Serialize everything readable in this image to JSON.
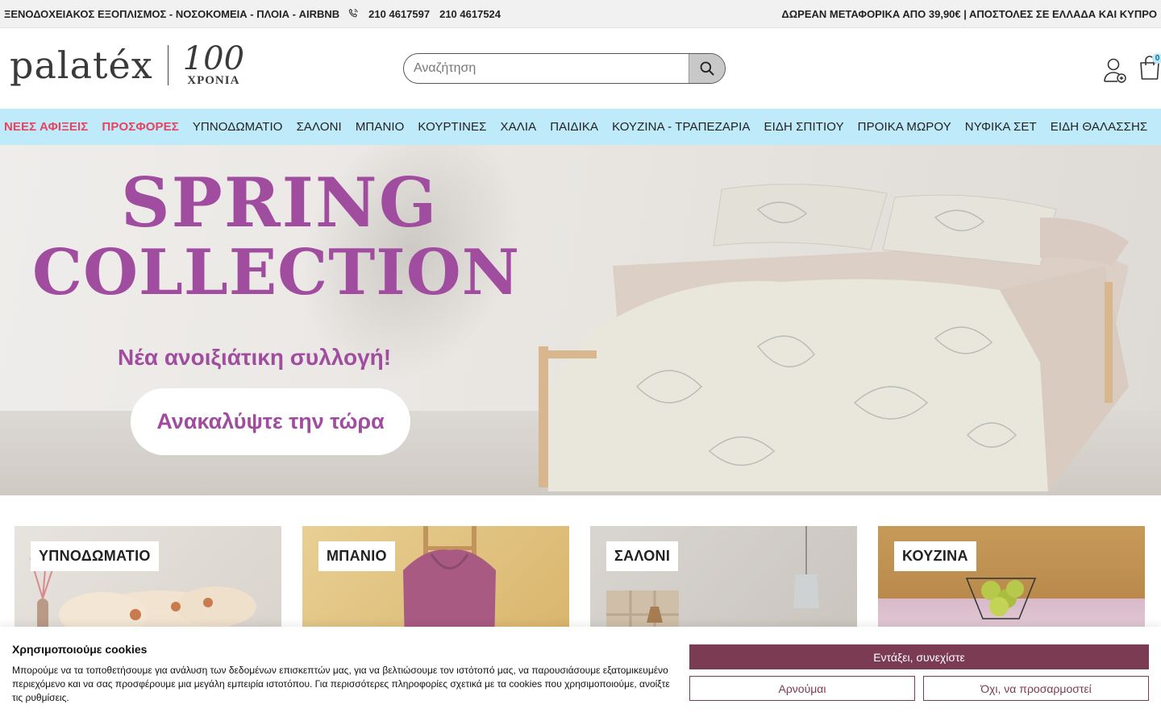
{
  "topbar": {
    "left_text": "ΞΕΝΟΔΟΧΕΙΑΚΟΣ ΕΞΟΠΛΙΣΜΟΣ - ΝΟΣΟΚΟΜΕΙΑ - ΠΛΟΙΑ - AIRBNB",
    "phone1": "210 4617597",
    "phone2": "210 4617524",
    "right_text": "ΔΩΡΕΑΝ ΜΕΤΑΦΟΡΙΚΑ ΑΠΟ 39,90€ | ΑΠΟΣΤΟΛΕΣ ΣΕ ΕΛΛΑΔΑ ΚΑΙ ΚΥΠΡΟ"
  },
  "header": {
    "logo_text": "palatéx",
    "logo_100": "100",
    "logo_years": "ΧΡΟΝΙΑ",
    "search_placeholder": "Αναζήτηση",
    "cart_count": "0"
  },
  "nav": {
    "items": [
      {
        "label": "ΝΕΕΣ ΑΦΙΞΕΙΣ",
        "highlight": true
      },
      {
        "label": "ΠΡΟΣΦΟΡΕΣ",
        "highlight": true
      },
      {
        "label": "ΥΠΝΟΔΩΜΑΤΙΟ",
        "highlight": false
      },
      {
        "label": "ΣΑΛΟΝΙ",
        "highlight": false
      },
      {
        "label": "ΜΠΑΝΙΟ",
        "highlight": false
      },
      {
        "label": "ΚΟΥΡΤΙΝΕΣ",
        "highlight": false
      },
      {
        "label": "ΧΑΛΙΑ",
        "highlight": false
      },
      {
        "label": "ΠΑΙΔΙΚΑ",
        "highlight": false
      },
      {
        "label": "ΚΟΥΖΙΝΑ - ΤΡΑΠΕΖΑΡΙΑ",
        "highlight": false
      },
      {
        "label": "ΕΙΔΗ ΣΠΙΤΙΟΥ",
        "highlight": false
      },
      {
        "label": "ΠΡΟΙΚΑ ΜΩΡΟΥ",
        "highlight": false
      },
      {
        "label": "ΝΥΦΙΚΑ ΣΕΤ",
        "highlight": false
      },
      {
        "label": "ΕΙΔΗ ΘΑΛΑΣΣΗΣ",
        "highlight": false
      }
    ]
  },
  "hero": {
    "title_line1": "SPRING",
    "title_line2": "COLLECTION",
    "subtitle": "Νέα ανοιξιάτικη συλλογή!",
    "cta": "Ανακαλύψτε την τώρα",
    "accent_color": "#a04c9f"
  },
  "categories": [
    {
      "label": "ΥΠΝΟΔΩΜΑΤΙΟ"
    },
    {
      "label": "ΜΠΑΝΙΟ"
    },
    {
      "label": "ΣΑΛΟΝΙ"
    },
    {
      "label": "ΚΟΥΖΙΝΑ"
    }
  ],
  "cookie": {
    "title": "Χρησιμοποιούμε cookies",
    "text": "Μπορούμε να τα τοποθετήσουμε για ανάλυση των δεδομένων επισκεπτών μας, για να βελτιώσουμε τον ιστότοπό μας, να παρουσιάσουμε εξατομικευμένο περιεχόμενο και να σας προσφέρουμε μια μεγάλη εμπειρία ιστοτόπου. Για περισσότερες πληροφορίες σχετικά με τα cookies που χρησιμοποιούμε, ανοίξτε τις ρυθμίσεις.",
    "accept": "Εντάξει, συνεχίστε",
    "deny": "Αρνούμαι",
    "customize": "Όχι, να προσαρμοστεί",
    "brand_color": "#7b3b52"
  }
}
